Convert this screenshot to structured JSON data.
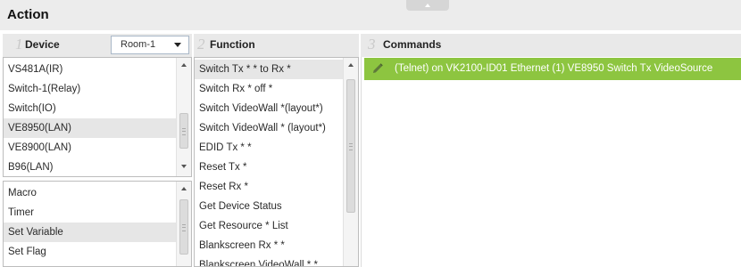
{
  "window": {
    "title": "Action"
  },
  "device_panel": {
    "number": "1",
    "label": "Device",
    "room_select": {
      "selected": "Room-1"
    },
    "items": [
      "VS481A(IR)",
      "Switch-1(Relay)",
      "Switch(IO)",
      "VE8950(LAN)",
      "VE8900(LAN)",
      "B96(LAN)"
    ],
    "selected_index": 3
  },
  "action_panel": {
    "items": [
      "Macro",
      "Timer",
      "Set Variable",
      "Set Flag"
    ],
    "selected_index": 2
  },
  "function_panel": {
    "number": "2",
    "label": "Function",
    "items": [
      "Switch Tx * * to Rx *",
      "Switch Rx * off *",
      "Switch VideoWall *(layout*)",
      "Switch VideoWall * (layout*)",
      "EDID Tx * *",
      "Reset Tx *",
      "Reset Rx *",
      "Get Device Status",
      "Get Resource * List",
      "Blankscreen Rx * *",
      "Blankscreen VideoWall * *"
    ],
    "selected_index": 0
  },
  "commands_panel": {
    "number": "3",
    "label": "Commands",
    "commands": [
      "(Telnet) on VK2100-ID01 Ethernet (1) VE8950 Switch Tx VideoSource"
    ],
    "highlight_color": "#8dc540",
    "icons": {
      "edit": "pencil-icon"
    }
  }
}
